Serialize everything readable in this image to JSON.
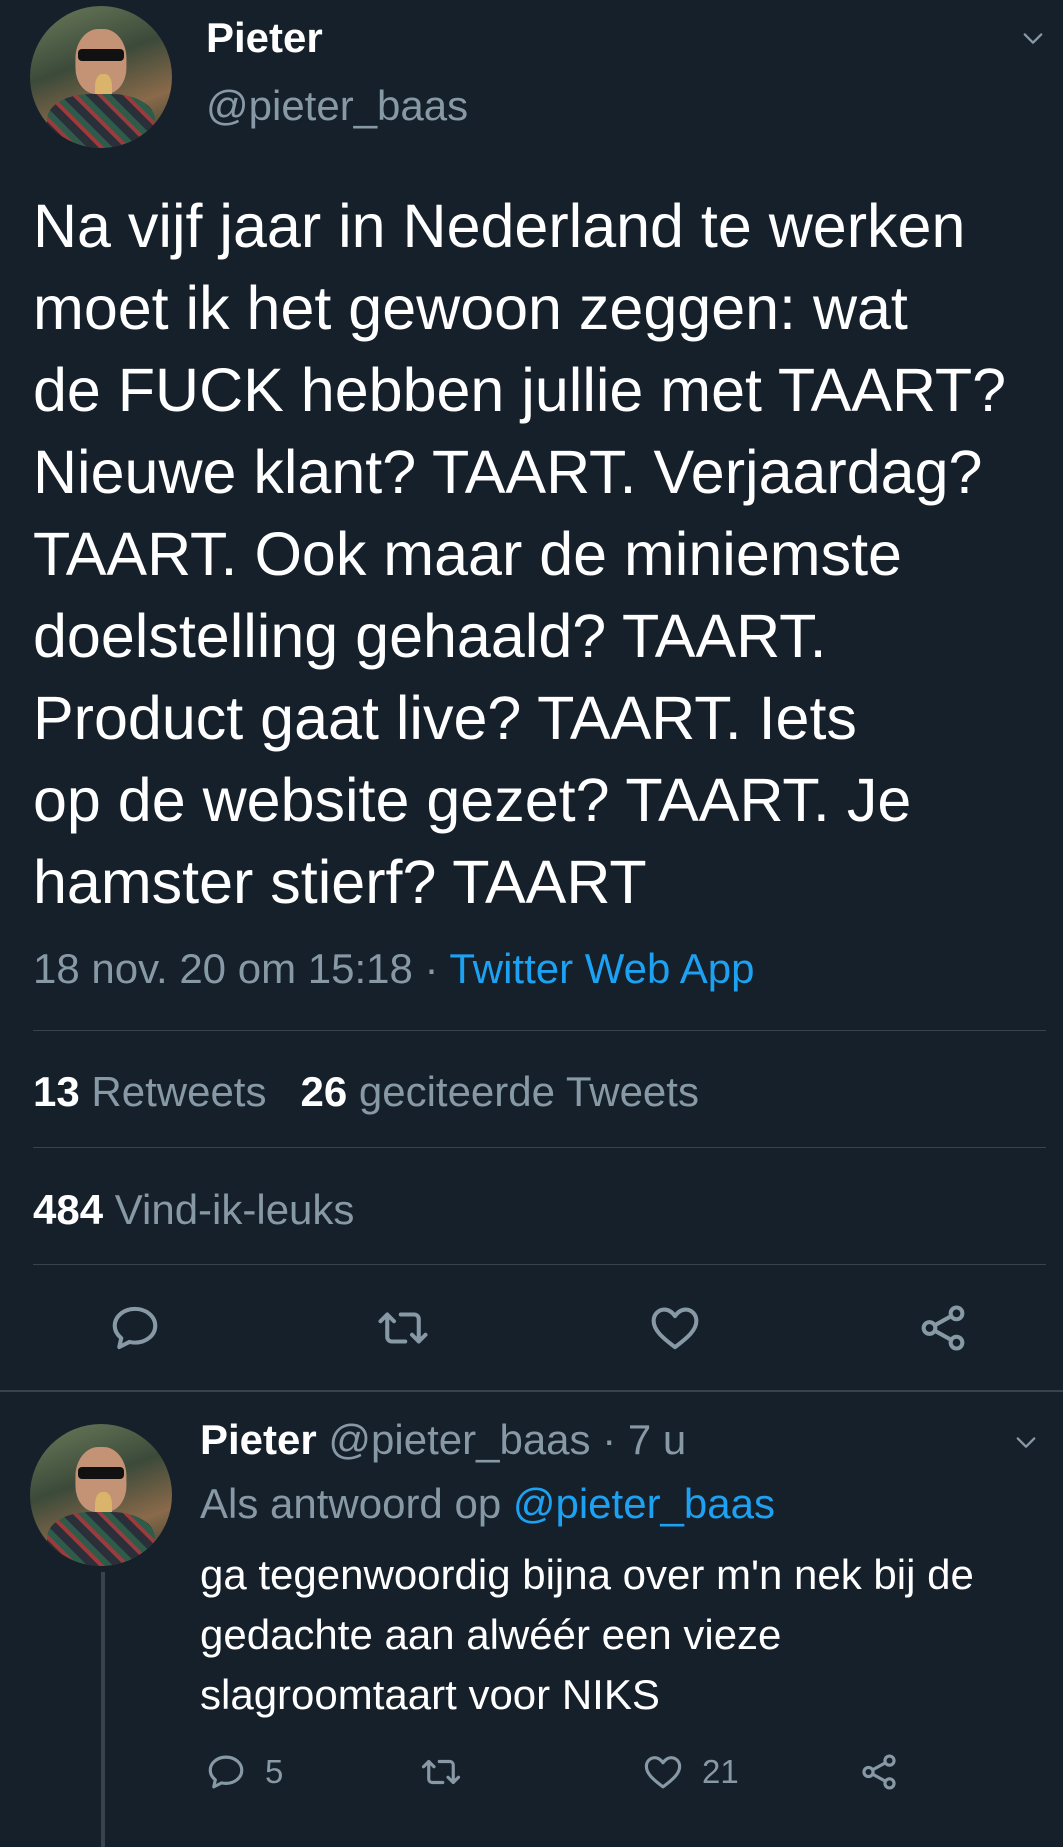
{
  "main_tweet": {
    "author": {
      "display_name": "Pieter",
      "handle": "@pieter_baas",
      "avatar_icon": "profile-photo"
    },
    "text": "Na vijf jaar in Nederland te werken\nmoet ik het gewoon zeggen: wat\nde FUCK hebben jullie met TAART?\nNieuwe klant? TAART. Verjaardag?\nTAART. Ook maar de miniemste\ndoelstelling gehaald? TAART.\nProduct gaat live? TAART. Iets\nop de website gezet? TAART. Je\nhamster stierf? TAART",
    "timestamp": "18 nov. 20 om 15:18",
    "separator": "·",
    "source": "Twitter Web App",
    "stats": {
      "retweets_count": "13",
      "retweets_label": "Retweets",
      "quotes_count": "26",
      "quotes_label": "geciteerde Tweets",
      "likes_count": "484",
      "likes_label": "Vind-ik-leuks"
    },
    "actions": [
      "reply-icon",
      "retweet-icon",
      "like-icon",
      "share-icon"
    ]
  },
  "reply_tweet": {
    "author": {
      "display_name": "Pieter",
      "handle": "@pieter_baas",
      "avatar_icon": "profile-photo"
    },
    "time_sep": "·",
    "age": "7 u",
    "reply_prefix": "Als antwoord op",
    "reply_mention": "@pieter_baas",
    "text": "ga tegenwoordig bijna over m'n nek bij de\ngedachte aan alwéér een vieze\nslagroomtaart voor NIKS",
    "reply_count": "5",
    "like_count": "21"
  },
  "colors": {
    "background": "#15202b",
    "secondary_text": "#8899a6",
    "link": "#1da1f2",
    "divider": "#38444d"
  }
}
